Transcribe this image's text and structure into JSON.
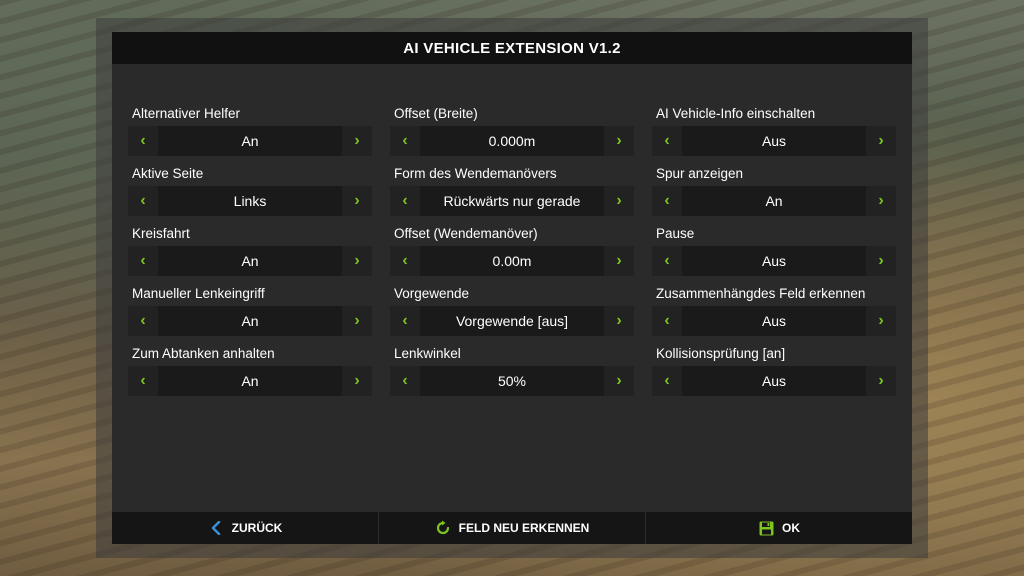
{
  "dialog": {
    "title": "AI VEHICLE EXTENSION V1.2"
  },
  "colors": {
    "accent": "#7ec41f",
    "back_arrow": "#3a8fd8"
  },
  "settings": [
    {
      "label": "Alternativer Helfer",
      "value": "An"
    },
    {
      "label": "Offset (Breite)",
      "value": "0.000m"
    },
    {
      "label": "AI Vehicle-Info einschalten",
      "value": "Aus"
    },
    {
      "label": "Aktive Seite",
      "value": "Links"
    },
    {
      "label": "Form des Wendemanövers",
      "value": "Rückwärts nur gerade"
    },
    {
      "label": "Spur anzeigen",
      "value": "An"
    },
    {
      "label": "Kreisfahrt",
      "value": "An"
    },
    {
      "label": "Offset (Wendemanöver)",
      "value": "0.00m"
    },
    {
      "label": "Pause",
      "value": "Aus"
    },
    {
      "label": "Manueller Lenkeingriff",
      "value": "An"
    },
    {
      "label": "Vorgewende",
      "value": "Vorgewende [aus]"
    },
    {
      "label": "Zusammenhängdes Feld erkennen",
      "value": "Aus"
    },
    {
      "label": "Zum Abtanken anhalten",
      "value": "An"
    },
    {
      "label": "Lenkwinkel",
      "value": "50%"
    },
    {
      "label": "Kollisionsprüfung [an]",
      "value": "Aus"
    }
  ],
  "arrows": {
    "left": "‹",
    "right": "›"
  },
  "footer": {
    "back_label": "ZURÜCK",
    "back_icon": "chevron-left-icon",
    "redetect_label": "FELD NEU ERKENNEN",
    "redetect_icon": "refresh-icon",
    "ok_label": "OK",
    "ok_icon": "save-icon"
  }
}
